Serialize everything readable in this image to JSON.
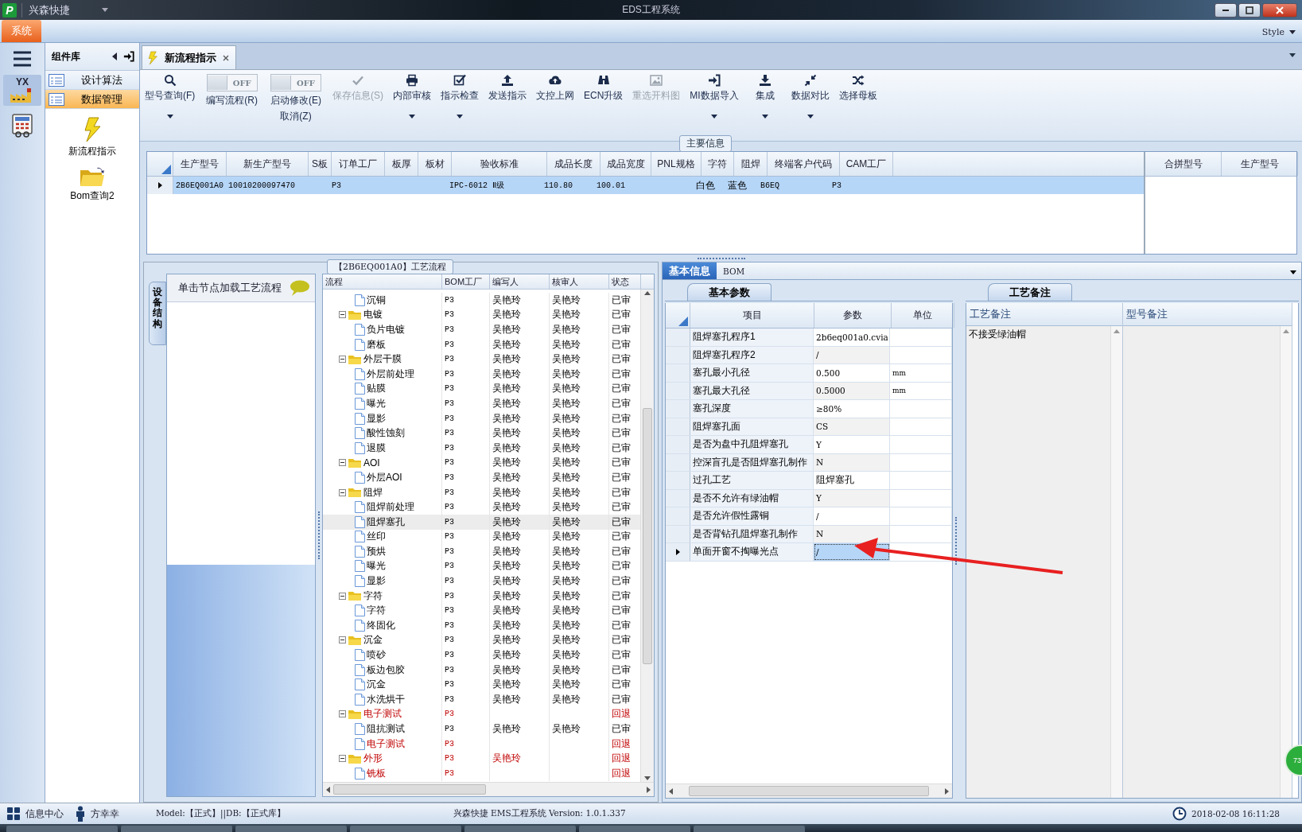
{
  "title_bar": {
    "logo": "P",
    "app_name": "兴森快捷",
    "title": "EDS工程系统"
  },
  "menu_bar": {
    "items": [
      {
        "label": "系统",
        "selected": true
      }
    ],
    "style_menu": "Style"
  },
  "sidebar": {
    "icons": [
      {
        "kind": "menu",
        "selected": false
      },
      {
        "kind": "factory",
        "label": "YX",
        "selected": true
      },
      {
        "kind": "calculator",
        "selected": false
      }
    ]
  },
  "component_library": {
    "title": "组件库",
    "items": [
      {
        "label": "设计算法",
        "selected": false
      },
      {
        "label": "数据管理",
        "selected": true
      }
    ],
    "shortcuts": [
      {
        "kind": "lightning",
        "label": "新流程指示"
      },
      {
        "kind": "folder",
        "label": "Bom查询2"
      }
    ]
  },
  "document_tabs": [
    {
      "label": "新流程指示",
      "selected": true
    }
  ],
  "toolbar": [
    {
      "kind": "search",
      "label": "型号查询(F)",
      "disabled": false,
      "dropdown": true
    },
    {
      "kind": "toggle",
      "switch_text": "OFF",
      "on": false,
      "label": "编写流程(R)"
    },
    {
      "kind": "toggle",
      "switch_text": "OFF",
      "on": false,
      "label": "启动修改(E)",
      "sublabel": "取消(Z)"
    },
    {
      "kind": "check",
      "label": "保存信息(S)",
      "disabled": true,
      "dropdown": false
    },
    {
      "kind": "print",
      "label": "内部审核",
      "disabled": false,
      "dropdown": true
    },
    {
      "kind": "checkbox",
      "label": "指示检查",
      "disabled": false,
      "dropdown": true
    },
    {
      "kind": "upload",
      "label": "发送指示",
      "disabled": false,
      "dropdown": false
    },
    {
      "kind": "cloud",
      "label": "文控上网",
      "disabled": false,
      "dropdown": false
    },
    {
      "kind": "binoculars",
      "label": "ECN升级",
      "disabled": false,
      "dropdown": false
    },
    {
      "kind": "image",
      "label": "重选开料图",
      "disabled": true,
      "dropdown": false
    },
    {
      "kind": "import",
      "label": "MI数据导入",
      "disabled": false,
      "dropdown": true
    },
    {
      "kind": "download",
      "label": "集成",
      "disabled": false,
      "dropdown": true
    },
    {
      "kind": "compress",
      "label": "数据对比",
      "disabled": false,
      "dropdown": true
    },
    {
      "kind": "shuffle",
      "label": "选择母板",
      "disabled": false,
      "dropdown": false
    }
  ],
  "main_info": {
    "title": "主要信息",
    "columns": [
      "生产型号",
      "新生产型号",
      "S板",
      "订单工厂",
      "板厚",
      "板材",
      "验收标准",
      "成品长度",
      "成品宽度",
      "PNL规格",
      "字符",
      "阻焊",
      "终端客户代码",
      "CAM工厂"
    ],
    "rows": [
      {
        "selected": true,
        "cells": [
          "2B6EQ001A0",
          "10010200097470",
          null,
          "P3",
          null,
          null,
          "IPC-6012 Ⅱ级",
          "110.80",
          "100.01",
          null,
          "白色",
          "蓝色",
          "B6EQ",
          "P3"
        ]
      }
    ],
    "side_columns": [
      "合拼型号",
      "生产型号"
    ]
  },
  "process_flow": {
    "title": "【2B6EQ001A0】工艺流程",
    "side_tab": "设备结构",
    "hint": "单击节点加载工艺流程",
    "columns": [
      "流程",
      "BOM工厂",
      "编写人",
      "核审人",
      "状态"
    ],
    "rows": [
      {
        "kind": "step",
        "name": "沉铜",
        "factory": "P3",
        "writer": "吴艳玲",
        "reviewer": "吴艳玲",
        "status": "已审",
        "rejected": false,
        "selected": false
      },
      {
        "kind": "folder",
        "name": "电镀",
        "factory": "P3",
        "writer": "吴艳玲",
        "reviewer": "吴艳玲",
        "status": "已审",
        "rejected": false,
        "selected": false,
        "children": [
          {
            "kind": "step",
            "name": "负片电镀",
            "factory": "P3",
            "writer": "吴艳玲",
            "reviewer": "吴艳玲",
            "status": "已审",
            "rejected": false,
            "selected": false
          },
          {
            "kind": "step",
            "name": "磨板",
            "factory": "P3",
            "writer": "吴艳玲",
            "reviewer": "吴艳玲",
            "status": "已审",
            "rejected": false,
            "selected": false
          }
        ]
      },
      {
        "kind": "folder",
        "name": "外层干膜",
        "factory": "P3",
        "writer": "吴艳玲",
        "reviewer": "吴艳玲",
        "status": "已审",
        "rejected": false,
        "selected": false,
        "children": [
          {
            "kind": "step",
            "name": "外层前处理",
            "factory": "P3",
            "writer": "吴艳玲",
            "reviewer": "吴艳玲",
            "status": "已审",
            "rejected": false,
            "selected": false
          },
          {
            "kind": "step",
            "name": "贴膜",
            "factory": "P3",
            "writer": "吴艳玲",
            "reviewer": "吴艳玲",
            "status": "已审",
            "rejected": false,
            "selected": false
          },
          {
            "kind": "step",
            "name": "曝光",
            "factory": "P3",
            "writer": "吴艳玲",
            "reviewer": "吴艳玲",
            "status": "已审",
            "rejected": false,
            "selected": false
          },
          {
            "kind": "step",
            "name": "显影",
            "factory": "P3",
            "writer": "吴艳玲",
            "reviewer": "吴艳玲",
            "status": "已审",
            "rejected": false,
            "selected": false
          },
          {
            "kind": "step",
            "name": "酸性蚀刻",
            "factory": "P3",
            "writer": "吴艳玲",
            "reviewer": "吴艳玲",
            "status": "已审",
            "rejected": false,
            "selected": false
          },
          {
            "kind": "step",
            "name": "退膜",
            "factory": "P3",
            "writer": "吴艳玲",
            "reviewer": "吴艳玲",
            "status": "已审",
            "rejected": false,
            "selected": false
          }
        ]
      },
      {
        "kind": "folder",
        "name": "AOI",
        "factory": "P3",
        "writer": "吴艳玲",
        "reviewer": "吴艳玲",
        "status": "已审",
        "rejected": false,
        "selected": false,
        "children": [
          {
            "kind": "step",
            "name": "外层AOI",
            "factory": "P3",
            "writer": "吴艳玲",
            "reviewer": "吴艳玲",
            "status": "已审",
            "rejected": false,
            "selected": false
          }
        ]
      },
      {
        "kind": "folder",
        "name": "阻焊",
        "factory": "P3",
        "writer": "吴艳玲",
        "reviewer": "吴艳玲",
        "status": "已审",
        "rejected": false,
        "selected": false,
        "children": [
          {
            "kind": "step",
            "name": "阻焊前处理",
            "factory": "P3",
            "writer": "吴艳玲",
            "reviewer": "吴艳玲",
            "status": "已审",
            "rejected": false,
            "selected": false
          },
          {
            "kind": "step",
            "name": "阻焊塞孔",
            "factory": "P3",
            "writer": "吴艳玲",
            "reviewer": "吴艳玲",
            "status": "已审",
            "rejected": false,
            "selected": true
          },
          {
            "kind": "step",
            "name": "丝印",
            "factory": "P3",
            "writer": "吴艳玲",
            "reviewer": "吴艳玲",
            "status": "已审",
            "rejected": false,
            "selected": false
          },
          {
            "kind": "step",
            "name": "预烘",
            "factory": "P3",
            "writer": "吴艳玲",
            "reviewer": "吴艳玲",
            "status": "已审",
            "rejected": false,
            "selected": false
          },
          {
            "kind": "step",
            "name": "曝光",
            "factory": "P3",
            "writer": "吴艳玲",
            "reviewer": "吴艳玲",
            "status": "已审",
            "rejected": false,
            "selected": false
          },
          {
            "kind": "step",
            "name": "显影",
            "factory": "P3",
            "writer": "吴艳玲",
            "reviewer": "吴艳玲",
            "status": "已审",
            "rejected": false,
            "selected": false
          }
        ]
      },
      {
        "kind": "folder",
        "name": "字符",
        "factory": "P3",
        "writer": "吴艳玲",
        "reviewer": "吴艳玲",
        "status": "已审",
        "rejected": false,
        "selected": false,
        "children": [
          {
            "kind": "step",
            "name": "字符",
            "factory": "P3",
            "writer": "吴艳玲",
            "reviewer": "吴艳玲",
            "status": "已审",
            "rejected": false,
            "selected": false
          },
          {
            "kind": "step",
            "name": "终固化",
            "factory": "P3",
            "writer": "吴艳玲",
            "reviewer": "吴艳玲",
            "status": "已审",
            "rejected": false,
            "selected": false
          }
        ]
      },
      {
        "kind": "folder",
        "name": "沉金",
        "factory": "P3",
        "writer": "吴艳玲",
        "reviewer": "吴艳玲",
        "status": "已审",
        "rejected": false,
        "selected": false,
        "children": [
          {
            "kind": "step",
            "name": "喷砂",
            "factory": "P3",
            "writer": "吴艳玲",
            "reviewer": "吴艳玲",
            "status": "已审",
            "rejected": false,
            "selected": false
          },
          {
            "kind": "step",
            "name": "板边包胶",
            "factory": "P3",
            "writer": "吴艳玲",
            "reviewer": "吴艳玲",
            "status": "已审",
            "rejected": false,
            "selected": false
          },
          {
            "kind": "step",
            "name": "沉金",
            "factory": "P3",
            "writer": "吴艳玲",
            "reviewer": "吴艳玲",
            "status": "已审",
            "rejected": false,
            "selected": false
          },
          {
            "kind": "step",
            "name": "水洗烘干",
            "factory": "P3",
            "writer": "吴艳玲",
            "reviewer": "吴艳玲",
            "status": "已审",
            "rejected": false,
            "selected": false
          }
        ]
      },
      {
        "kind": "folder",
        "name": "电子测试",
        "factory": "P3",
        "status": "回退",
        "rejected": true,
        "selected": false,
        "children": [
          {
            "kind": "step",
            "name": "阻抗测试",
            "factory": "P3",
            "writer": "吴艳玲",
            "reviewer": "吴艳玲",
            "status": "已审",
            "rejected": false,
            "selected": false
          },
          {
            "kind": "step",
            "name": "电子测试",
            "factory": "P3",
            "status": "回退",
            "rejected": true,
            "selected": false
          }
        ]
      },
      {
        "kind": "folder",
        "name": "外形",
        "factory": "P3",
        "writer": "吴艳玲",
        "status": "回退",
        "rejected": true,
        "selected": false,
        "children": [
          {
            "kind": "step",
            "name": "铣板",
            "factory": "P3",
            "status": "回退",
            "rejected": true,
            "selected": false
          }
        ]
      }
    ]
  },
  "detail_tabs": [
    {
      "label": "基本信息",
      "selected": true
    },
    {
      "label": "BOM",
      "selected": false
    }
  ],
  "parameters": {
    "tab": "基本参数",
    "columns": [
      "项目",
      "参数",
      "单位"
    ],
    "rows": [
      {
        "item": "阻焊塞孔程序1",
        "value": "2b6eq001a0.cvia",
        "selected": false
      },
      {
        "item": "阻焊塞孔程序2",
        "value": "/",
        "selected": false
      },
      {
        "item": "塞孔最小孔径",
        "value": "0.500",
        "unit": "mm",
        "selected": false
      },
      {
        "item": "塞孔最大孔径",
        "value": "0.5000",
        "unit": "mm",
        "selected": false
      },
      {
        "item": "塞孔深度",
        "value": "≥80%",
        "selected": false
      },
      {
        "item": "阻焊塞孔面",
        "value": "CS",
        "selected": false
      },
      {
        "item": "是否为盘中孔阻焊塞孔",
        "value": "Y",
        "selected": false
      },
      {
        "item": "控深盲孔是否阻焊塞孔制作",
        "value": "N",
        "selected": false
      },
      {
        "item": "过孔工艺",
        "value": "阻焊塞孔",
        "selected": false
      },
      {
        "item": "是否不允许有绿油帽",
        "value": "Y",
        "selected": false
      },
      {
        "item": "是否允许假性露铜",
        "value": "/",
        "selected": false
      },
      {
        "item": "是否背钻孔阻焊塞孔制作",
        "value": "N",
        "selected": false
      },
      {
        "item": "单面开窗不掏曝光点",
        "value": "/",
        "selected": true
      }
    ]
  },
  "remarks": {
    "tab": "工艺备注",
    "columns": [
      "工艺备注",
      "型号备注"
    ],
    "notes": [
      "不接受绿油帽"
    ]
  },
  "status_bar": {
    "info_center": "信息中心",
    "user": "方幸幸",
    "model": "Model:【正式】||DB:【正式库】",
    "version": "兴森快捷 EMS工程系统 Version: 1.0.1.337",
    "datetime": "2018-02-08 16:11:28"
  },
  "notification_badge": "73"
}
